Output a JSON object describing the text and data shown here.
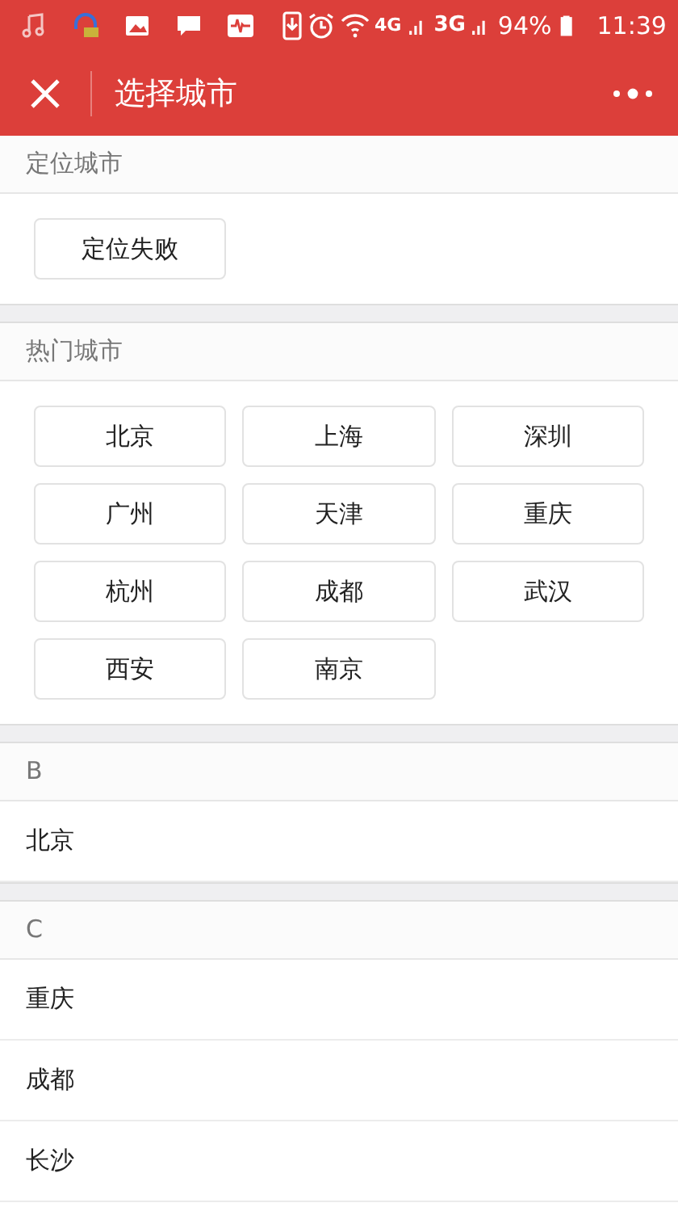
{
  "status_bar": {
    "network_1": "4G",
    "network_2": "3G",
    "battery": "94%",
    "time": "11:39"
  },
  "toolbar": {
    "title": "选择城市"
  },
  "location": {
    "heading": "定位城市",
    "button": "定位失败"
  },
  "hot": {
    "heading": "热门城市",
    "cities": [
      "北京",
      "上海",
      "深圳",
      "广州",
      "天津",
      "重庆",
      "杭州",
      "成都",
      "武汉",
      "西安",
      "南京"
    ]
  },
  "groups": [
    {
      "letter": "B",
      "cities": [
        "北京"
      ]
    },
    {
      "letter": "C",
      "cities": [
        "重庆",
        "成都",
        "长沙"
      ]
    }
  ]
}
